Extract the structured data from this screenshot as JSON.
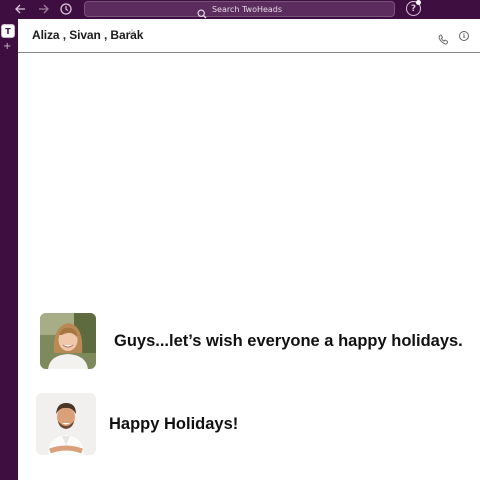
{
  "topbar": {
    "back_icon": "arrow-left-icon",
    "forward_icon": "arrow-right-icon",
    "history_icon": "clock-icon",
    "search_placeholder": "Search TwoHeads",
    "help_label": "?"
  },
  "sidebar": {
    "workspace_initial": "T",
    "add_label": "+"
  },
  "channel": {
    "title": "Aliza , Sivan , Barak",
    "star": "☆"
  },
  "messages": [
    {
      "text": "Guys...let’s wish everyone a happy holidays."
    },
    {
      "text": "Happy Holidays!"
    }
  ],
  "colors": {
    "aubergine": "#3f0e40",
    "search_bg": "#5b2c5d",
    "text": "#111111"
  }
}
